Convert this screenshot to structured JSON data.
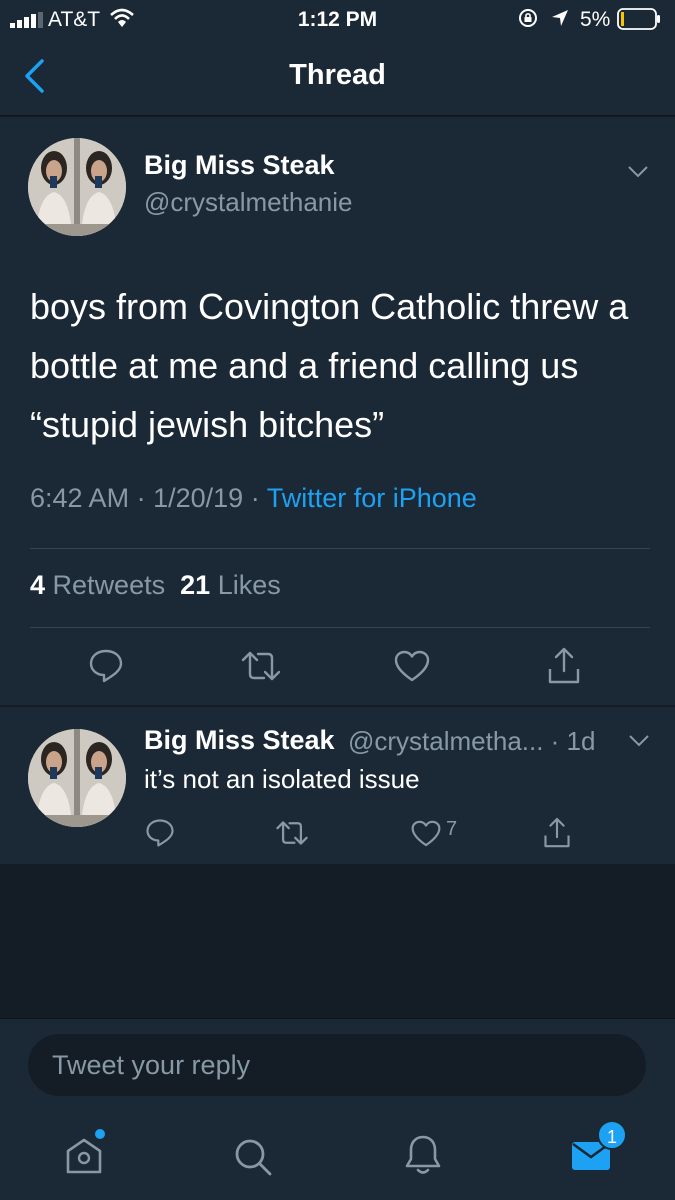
{
  "status_bar": {
    "carrier": "AT&T",
    "time": "1:12 PM",
    "battery_percent": "5%"
  },
  "nav": {
    "title": "Thread"
  },
  "main_tweet": {
    "name": "Big Miss Steak",
    "handle": "@crystalmethanie",
    "text": "boys from Covington Catholic threw a bottle at me and a friend calling us “stupid jewish bitches”",
    "time": "6:42 AM",
    "date": "1/20/19",
    "separator": "·",
    "source": "Twitter for iPhone",
    "retweets_count": "4",
    "retweets_label": "Retweets",
    "likes_count": "21",
    "likes_label": "Likes"
  },
  "reply_tweet": {
    "name": "Big Miss Steak",
    "handle_time": "@crystalmetha... · 1d",
    "text": "it’s not an isolated issue",
    "likes": "7"
  },
  "compose": {
    "placeholder": "Tweet your reply"
  },
  "tab_bar": {
    "messages_badge": "1"
  },
  "colors": {
    "accent": "#1da1f2",
    "background": "#141d26",
    "surface": "#1b2836",
    "muted_text": "#8899a6"
  },
  "icons": [
    "signal-icon",
    "wifi-icon",
    "rotation-lock-icon",
    "location-icon",
    "battery-icon",
    "back-chevron-icon",
    "chevron-down-icon",
    "reply-icon",
    "retweet-icon",
    "like-icon",
    "share-icon",
    "home-icon",
    "search-icon",
    "notifications-icon",
    "messages-icon"
  ]
}
